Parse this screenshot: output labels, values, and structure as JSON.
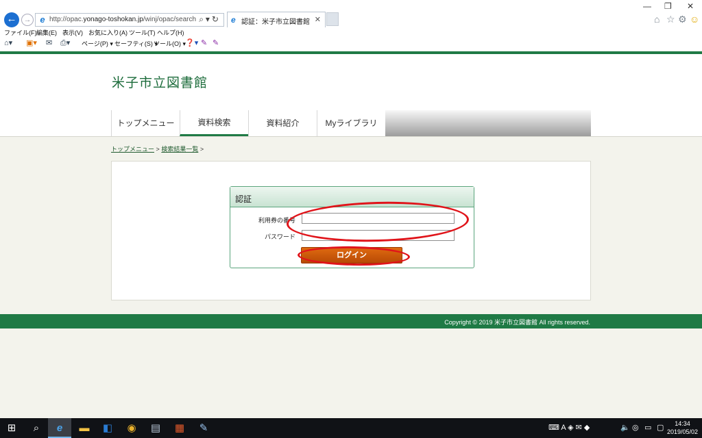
{
  "browser": {
    "url_prefix": "http://opac.",
    "url_host": "yonago-toshokan.jp",
    "url_path": "/winj/opac/search-list.do",
    "tab_title": "認証：米子市立図書館",
    "menu": [
      "ファイル(F)",
      "編集(E)",
      "表示(V)",
      "お気に入り(A)",
      "ツール(T)",
      "ヘルプ(H)"
    ],
    "commands": {
      "page": "ページ(P) ▾",
      "safety": "セーフティ(S) ▾",
      "tools": "ツール(O) ▾"
    }
  },
  "site": {
    "title": "米子市立図書館",
    "tabs": [
      {
        "label": "トップメニュー"
      },
      {
        "label": "資料検索"
      },
      {
        "label": "資料紹介"
      },
      {
        "label": "Myライブラリ"
      }
    ],
    "active_tab": "資料検索",
    "accent_color": "#1f7a45"
  },
  "breadcrumb": {
    "items": [
      "トップメニュー",
      "検索結果一覧"
    ],
    "separator": ">"
  },
  "auth": {
    "heading": "認証",
    "card_label": "利用券の番号",
    "card_value": "",
    "password_label": "パスワード",
    "password_value": "",
    "login_label": "ログイン"
  },
  "footer": {
    "copyright": "Copyright © 2019 米子市立図書館 All rights reserved."
  },
  "taskbar": {
    "time": "14:34",
    "date": "2019/05/02"
  }
}
